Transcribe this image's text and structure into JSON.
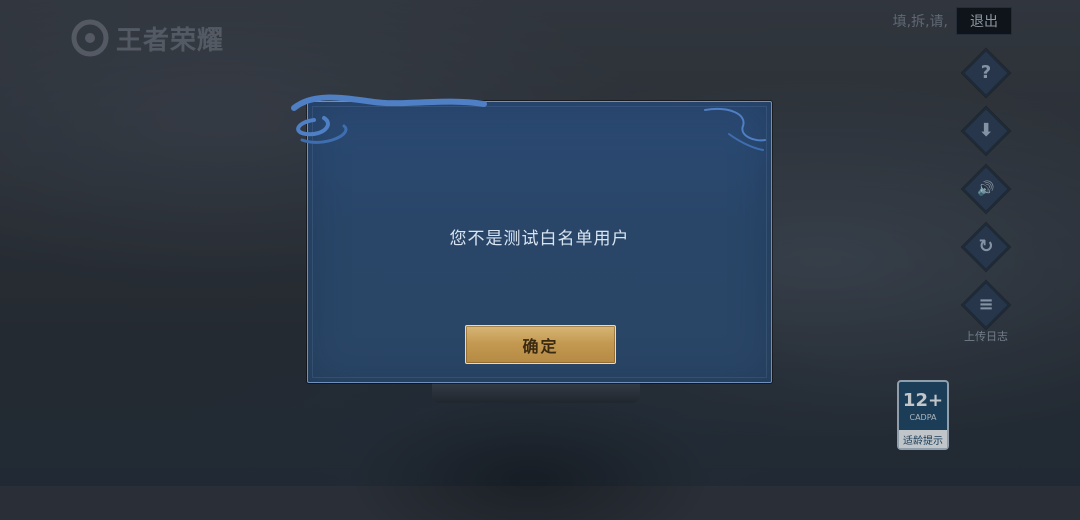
{
  "app": {
    "logo_text": "王者荣耀"
  },
  "top_bar": {
    "status_text": "填,拆,请,",
    "exit_label": "退出"
  },
  "side_menu": {
    "items": [
      {
        "icon": "help-icon",
        "glyph": "?"
      },
      {
        "icon": "download-icon",
        "glyph": "⬇"
      },
      {
        "icon": "sound-icon",
        "glyph": "🔊"
      },
      {
        "icon": "repair-icon",
        "glyph": "↻"
      },
      {
        "icon": "upload-log-icon",
        "glyph": "≡",
        "label": "上传日志"
      }
    ]
  },
  "age_rating": {
    "number": "12+",
    "org": "CADPA",
    "tip": "适龄提示"
  },
  "dialog": {
    "message": "您不是测试白名单用户",
    "confirm_label": "确定"
  },
  "colors": {
    "dialog_bg": "#2b4a74",
    "dialog_border": "#6f8fbd",
    "button_gold": "#c49a52",
    "text_light": "#d9e4f2"
  }
}
